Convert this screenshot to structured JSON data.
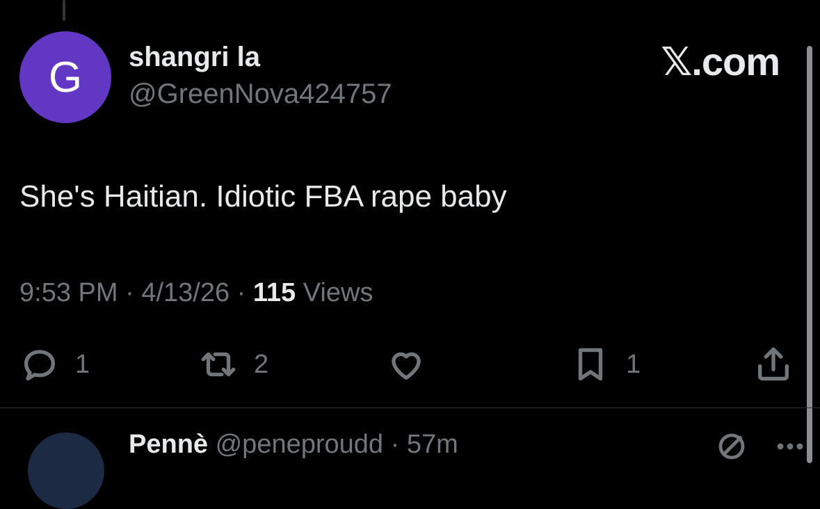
{
  "tweet": {
    "avatar_letter": "G",
    "display_name": "shangri la",
    "handle": "@GreenNova424757",
    "brand": "𝕏.com",
    "text": "She's Haitian. Idiotic FBA rape baby",
    "time": "9:53 PM",
    "date": "4/13/26",
    "views_count": "115",
    "views_label": "Views",
    "separator": "·"
  },
  "actions": {
    "reply": {
      "icon": "reply-icon",
      "count": "1"
    },
    "repost": {
      "icon": "repost-icon",
      "count": "2"
    },
    "like": {
      "icon": "heart-icon",
      "count": ""
    },
    "bookmark": {
      "icon": "bookmark-icon",
      "count": "1"
    },
    "share": {
      "icon": "share-icon",
      "count": ""
    }
  },
  "next_reply": {
    "display_name": "Pennè",
    "handle": "@peneproudd",
    "time": "57m"
  },
  "colors": {
    "background": "#000000",
    "text_primary": "#e7e9ea",
    "text_secondary": "#71767b",
    "avatar_bg": "#6237c4"
  }
}
